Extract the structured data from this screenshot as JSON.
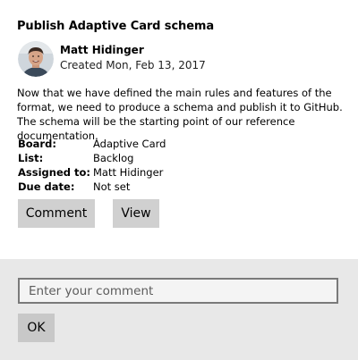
{
  "card": {
    "title": "Publish Adaptive Card schema",
    "author": {
      "name": "Matt Hidinger",
      "created": "Created Mon, Feb 13, 2017"
    },
    "description": "Now that we have defined the main rules and features of the format, we need to produce a schema and publish it to GitHub. The schema will be the starting point of our reference documentation.",
    "facts": [
      {
        "key": "Board:",
        "value": "Adaptive Card"
      },
      {
        "key": "List:",
        "value": "Backlog"
      },
      {
        "key": "Assigned to:",
        "value": "Matt Hidinger"
      },
      {
        "key": "Due date:",
        "value": "Not set"
      }
    ],
    "actions": {
      "comment_label": "Comment",
      "view_label": "View"
    }
  },
  "comment_form": {
    "placeholder": "Enter your comment",
    "value": "",
    "ok_label": "OK"
  },
  "colors": {
    "button_bg": "#d0d0d0",
    "footer_bg": "#e8e8e8",
    "input_border": "#7a7a7a"
  }
}
